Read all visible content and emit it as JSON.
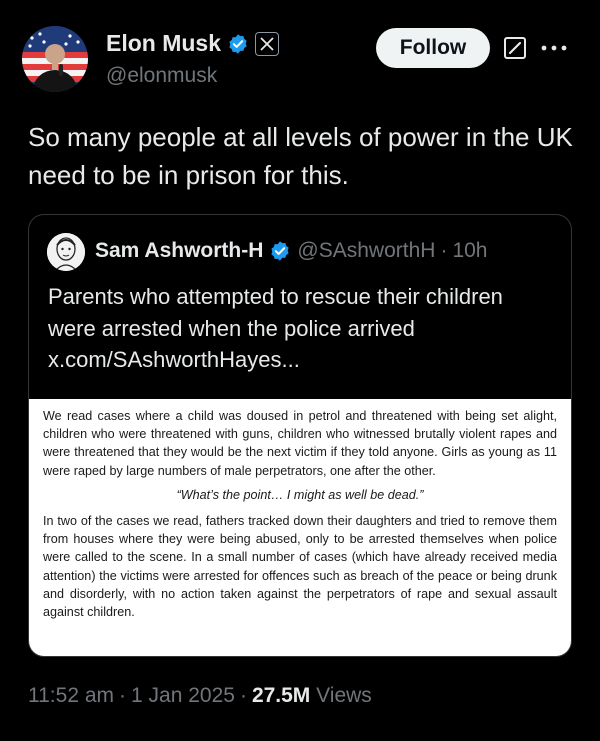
{
  "author": {
    "name": "Elon Musk",
    "handle": "@elonmusk"
  },
  "actions": {
    "follow_label": "Follow"
  },
  "tweet": {
    "text": "So many people at all levels of power in the UK need to be in prison for this."
  },
  "quoted": {
    "name": "Sam Ashworth-H",
    "handle": "@SAshworthH",
    "time": "10h",
    "text_prefix": "Parents who attempted to rescue their children were arrested when the police arrived",
    "link": "x.com/SAshworthHayes...",
    "document": {
      "para1": "We read cases where a child was doused in petrol and threatened with being set alight, children who were threatened with guns, children who witnessed brutally violent rapes and were threatened that they would be the next victim if they told anyone. Girls as young as 11 were raped by large numbers of male perpetrators, one after the other.",
      "quote": "“What’s the point… I might as well be dead.”",
      "para2": "In two of the cases we read, fathers tracked down their daughters and tried to remove them from houses where they were being abused, only to be arrested themselves when police were called to the scene. In a small number of cases (which have already received media attention) the victims were arrested for offences such as breach of the peace or being drunk and disorderly, with no action taken against the perpetrators of rape and sexual assault against children."
    }
  },
  "meta": {
    "time": "11:52 am",
    "date": "1 Jan 2025",
    "views_count": "27.5M",
    "views_label": "Views"
  },
  "icons": {
    "verified": "verified-badge-icon",
    "affiliate": "x-logo-icon",
    "grok": "grok-icon",
    "more": "more-icon"
  },
  "colors": {
    "background": "#000000",
    "verified": "#1d9bf0",
    "muted_text": "#71767b",
    "follow_bg": "#eff3f4"
  }
}
